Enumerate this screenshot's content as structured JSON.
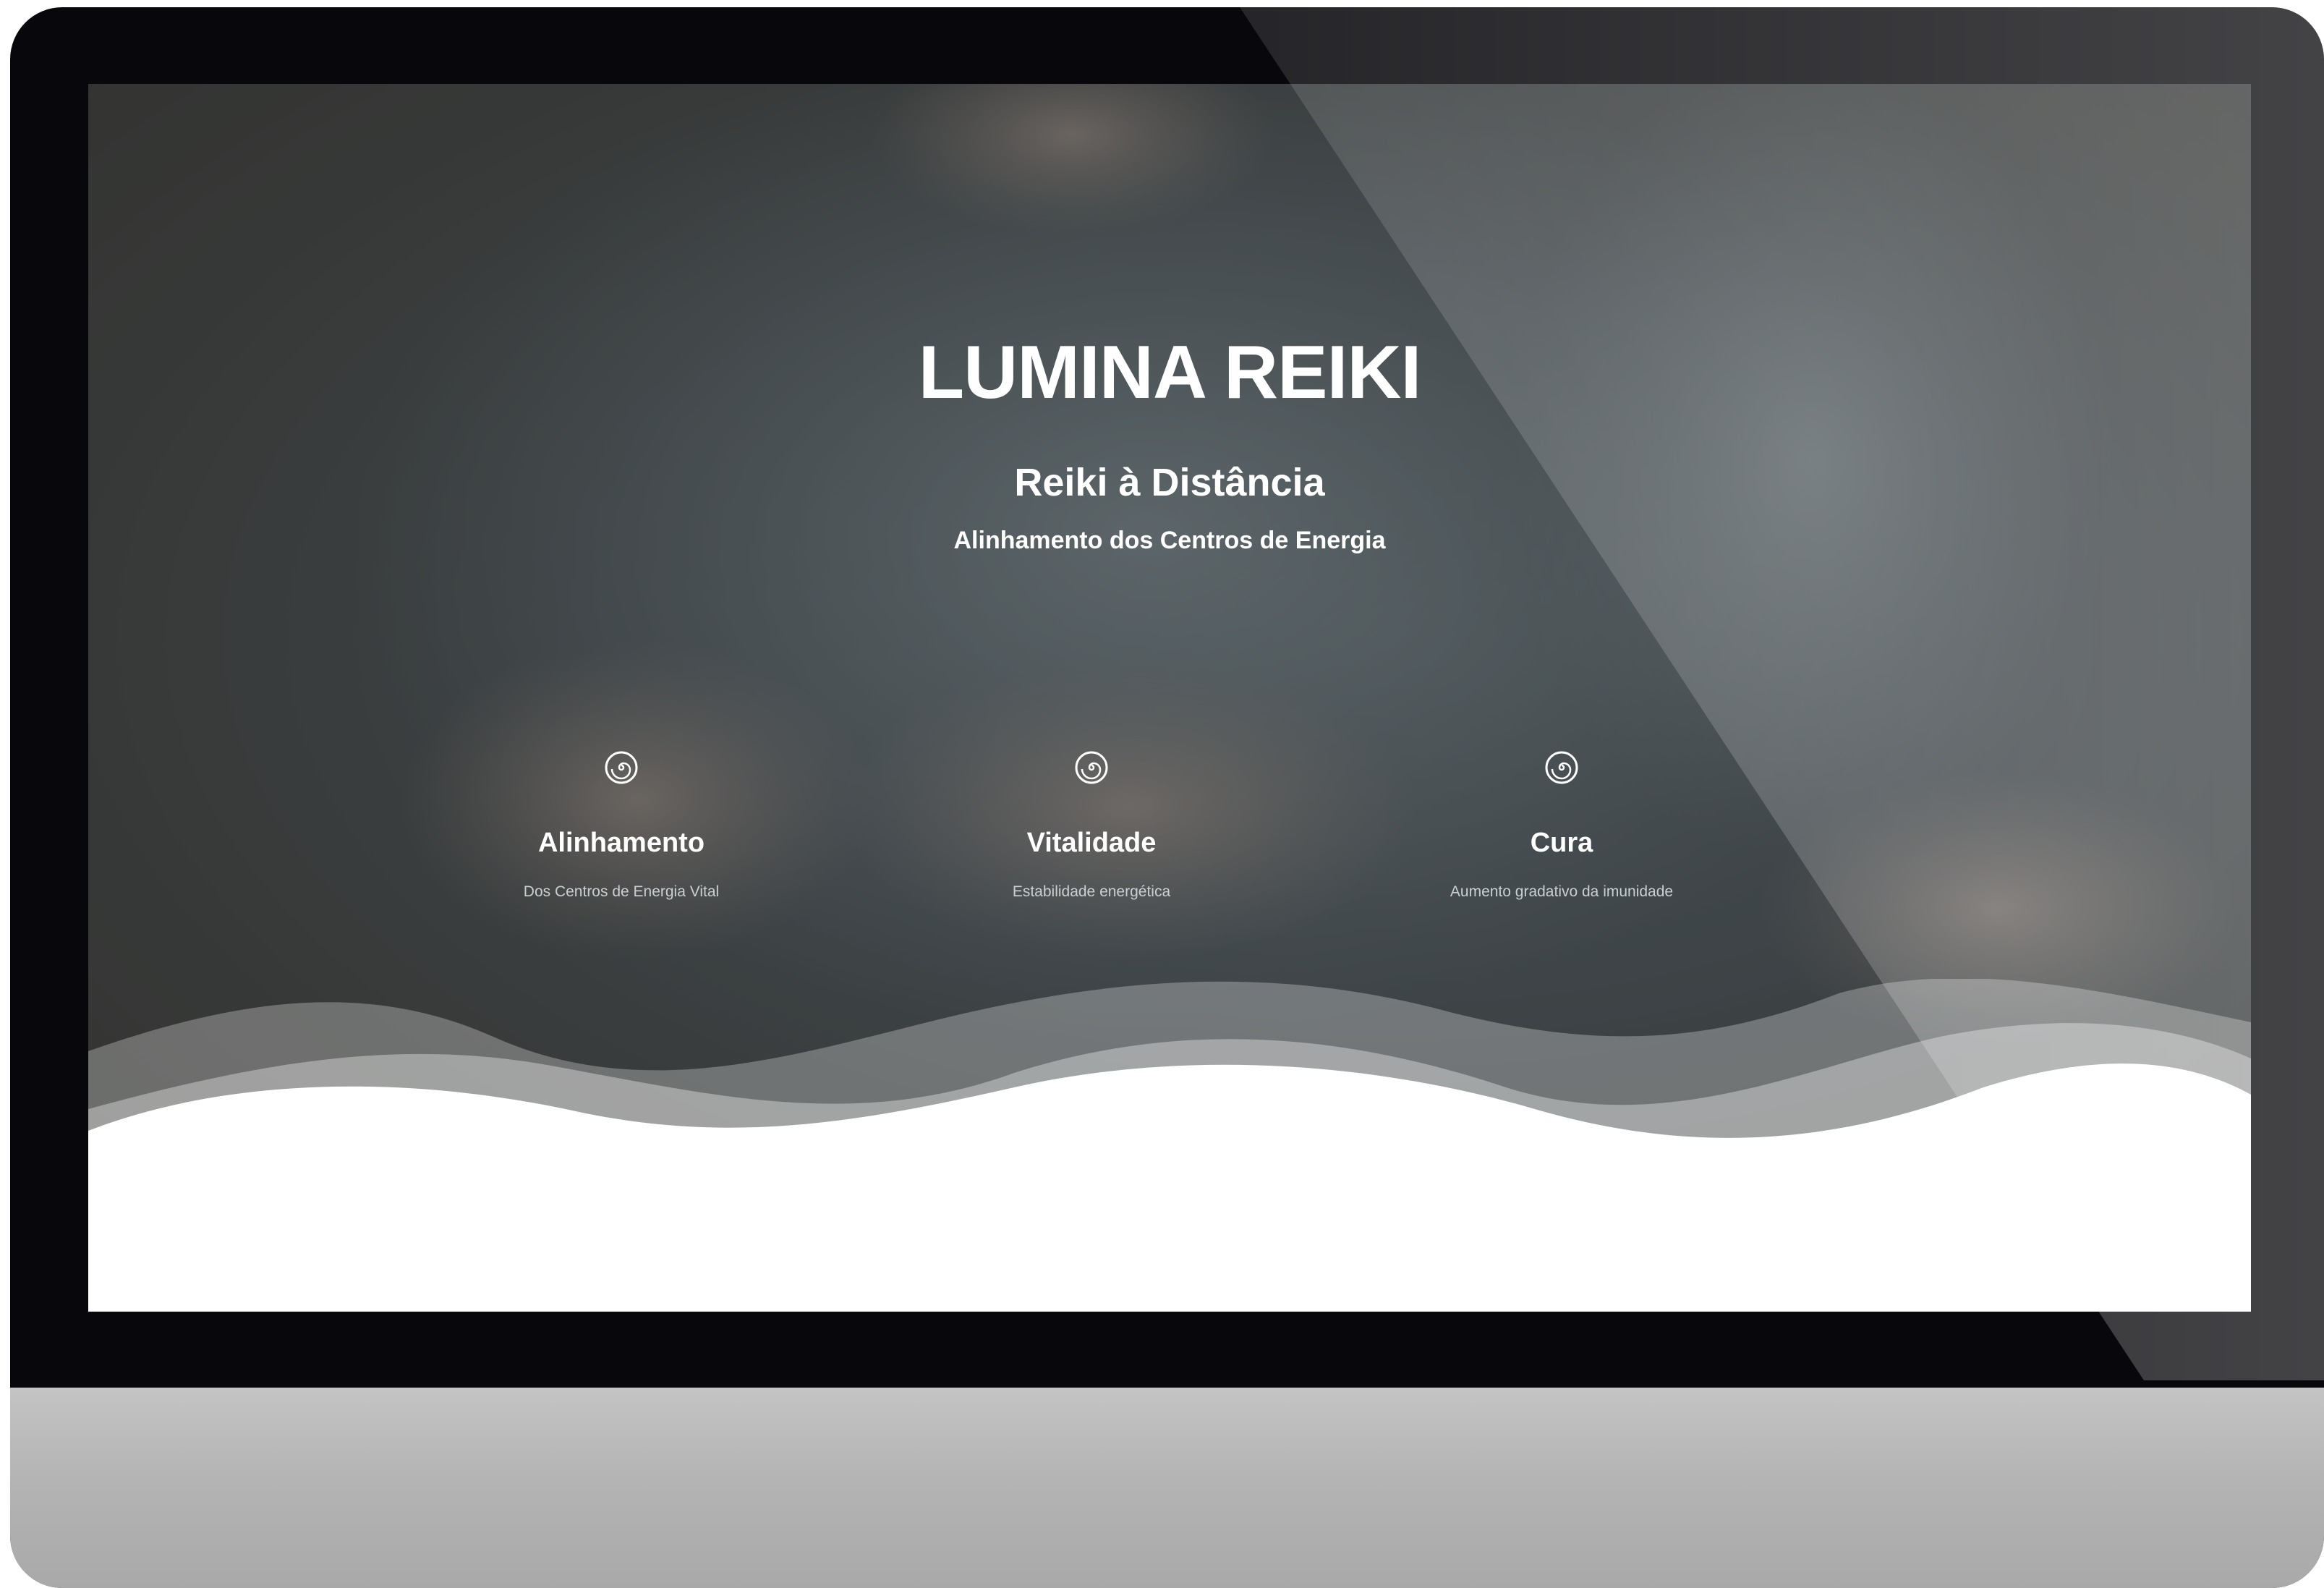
{
  "hero": {
    "brand": "LUMINA REIKI",
    "subtitle": "Reiki à Distância",
    "tagline": "Alinhamento dos Centros de Energia"
  },
  "features": [
    {
      "icon": "spiral-icon",
      "title": "Alinhamento",
      "description": "Dos Centros de Energia Vital"
    },
    {
      "icon": "spiral-icon",
      "title": "Vitalidade",
      "description": "Estabilidade energética"
    },
    {
      "icon": "spiral-icon",
      "title": "Cura",
      "description": "Aumento gradativo da imunidade"
    }
  ],
  "colors": {
    "text": "#ffffff",
    "overlay": "#3f4649",
    "bezel": "#08080c",
    "chin": "#b4b4b4",
    "wave": "#ffffff"
  }
}
